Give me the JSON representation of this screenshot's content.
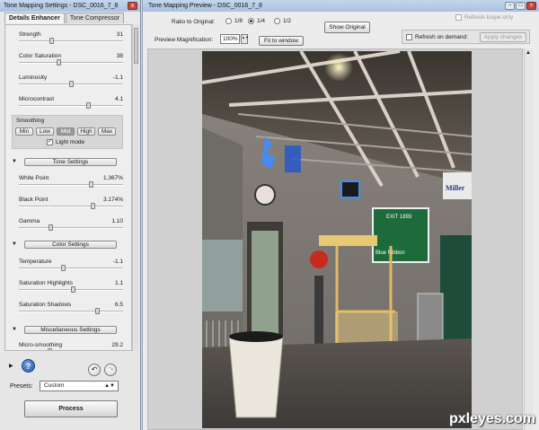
{
  "left_window": {
    "title": "Tone Mapping Settings - DSC_0016_7_8",
    "close_glyph": "x",
    "tabs": [
      {
        "label": "Details Enhancer",
        "active": true
      },
      {
        "label": "Tone Compressor",
        "active": false
      }
    ],
    "sliders_top": [
      {
        "label": "Strength",
        "value": "31",
        "pos": 0.31
      },
      {
        "label": "Color Saturation",
        "value": "38",
        "pos": 0.38
      },
      {
        "label": "Luminosity",
        "value": "-1.1",
        "pos": 0.5
      },
      {
        "label": "Microcontrast",
        "value": "4.1",
        "pos": 0.68
      }
    ],
    "smoothing": {
      "title": "Smoothing",
      "buttons": [
        "Min",
        "Low",
        "Mid",
        "High",
        "Max"
      ],
      "active": "Mid",
      "light_mode_label": "Light mode",
      "light_mode_checked": true,
      "check_glyph": "✓"
    },
    "tone_settings": {
      "label": "Tone Settings",
      "sliders": [
        {
          "label": "White Point",
          "value": "1.367%",
          "pos": 0.7
        },
        {
          "label": "Black Point",
          "value": "3.174%",
          "pos": 0.72
        },
        {
          "label": "Gamma",
          "value": "1.10",
          "pos": 0.3
        }
      ]
    },
    "color_settings": {
      "label": "Color Settings",
      "sliders": [
        {
          "label": "Temperature",
          "value": "-1.1",
          "pos": 0.42
        },
        {
          "label": "Saturation Highlights",
          "value": "1.1",
          "pos": 0.52
        },
        {
          "label": "Saturation Shadows",
          "value": "6.5",
          "pos": 0.77
        }
      ]
    },
    "misc_settings": {
      "label": "Miscellaneous Settings",
      "sliders": [
        {
          "label": "Micro-smoothing",
          "value": "29.2",
          "pos": 0.29
        }
      ]
    },
    "expand_glyph": "▼",
    "bottom": {
      "expand_glyph": "▶",
      "help_glyph": "?",
      "undo_glyph": "↶",
      "redo_glyph": "↷",
      "presets_label": "Presets:",
      "presets_value": "Custom",
      "presets_arrow": "▲▼",
      "process_label": "Process"
    }
  },
  "right_window": {
    "title": "Tone Mapping Preview - DSC_0016_7_8",
    "window_buttons": [
      "–",
      "□",
      "x"
    ],
    "ratio_label": "Ratio to Original:",
    "ratio_options": [
      {
        "label": "1/8",
        "selected": false
      },
      {
        "label": "1/4",
        "selected": true
      },
      {
        "label": "1/2",
        "selected": false
      }
    ],
    "show_original_label": "Show Original",
    "refresh_loupe_label": "Refresh loupe only",
    "magnification_label": "Preview Magnification:",
    "magnification_value": "100%",
    "spin_glyphs": "▲▼",
    "fit_label": "Fit to window",
    "refresh_demand_label": "Refresh on demand:",
    "apply_label": "Apply changes",
    "scroll_up_glyph": "▲",
    "photo_signs": {
      "exit_sign_top": "EXIT 1893",
      "exit_sign_bottom": "Blue Ribbon",
      "miller_sign": "Miller"
    }
  },
  "watermark": "pxleyes.com",
  "colors": {
    "titlebar": "#b7cbe5",
    "panel_bg": "#eeeeee",
    "help_blue": "#2155a6"
  }
}
